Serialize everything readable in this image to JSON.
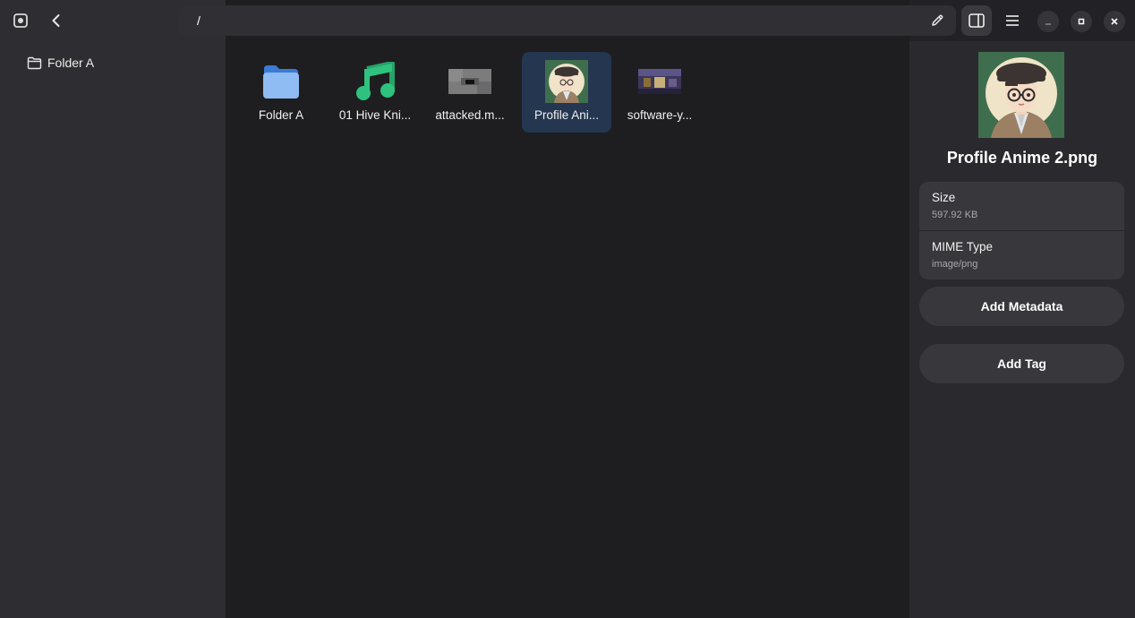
{
  "sidebar": {
    "items": [
      {
        "label": "Folder A",
        "icon": "folder-outline-icon"
      }
    ]
  },
  "header": {
    "path": "/"
  },
  "files": [
    {
      "name": "Folder A",
      "icon": "folder-icon",
      "selected": false
    },
    {
      "name": "01 Hive Kni...",
      "icon": "music-note-icon",
      "selected": false
    },
    {
      "name": "attacked.m...",
      "icon": "image-thumbnail",
      "selected": false
    },
    {
      "name": "Profile Ani...",
      "icon": "avatar-thumbnail",
      "selected": true
    },
    {
      "name": "software-y...",
      "icon": "image-thumbnail",
      "selected": false
    }
  ],
  "details": {
    "title": "Profile Anime 2.png",
    "properties": [
      {
        "key": "Size",
        "value": "597.92 KB"
      },
      {
        "key": "MIME Type",
        "value": "image/png"
      }
    ],
    "add_metadata_label": "Add Metadata",
    "add_tag_label": "Add Tag"
  },
  "colors": {
    "accent_folder": "#5ea0ef",
    "music_green": "#2ec27e",
    "selection": "#253650"
  }
}
